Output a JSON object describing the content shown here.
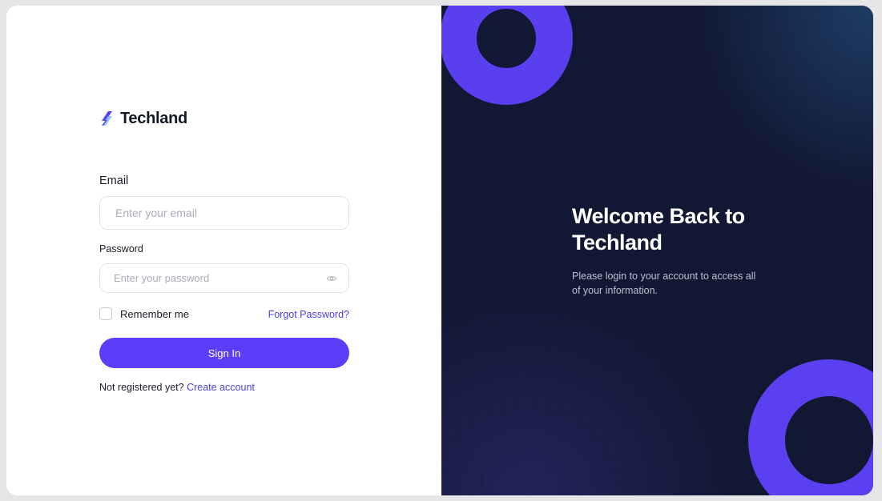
{
  "brand": {
    "name": "Techland",
    "logo_icon": "slash-stripe-logo",
    "logo_colors": [
      "#5b3ff8",
      "#7ec3ff"
    ]
  },
  "form": {
    "email_label": "Email",
    "email_placeholder": "Enter your email",
    "email_value": "",
    "password_label": "Password",
    "password_placeholder": "Enter your password",
    "password_value": "",
    "password_toggle_icon": "eye-icon",
    "remember_label": "Remember me",
    "remember_checked": false,
    "forgot_label": "Forgot Password?",
    "signin_label": "Sign In",
    "register_prompt": "Not registered yet?",
    "register_link": "Create account"
  },
  "promo": {
    "title": "Welcome Back to Techland",
    "description": "Please login to your account to access all of your information."
  },
  "colors": {
    "accent": "#5b3ff8",
    "link": "#4b3fe0",
    "panel_dark": "#111834",
    "text_dark": "#1a1d29"
  }
}
